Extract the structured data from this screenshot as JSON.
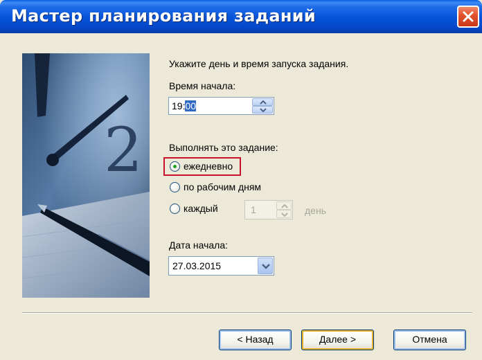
{
  "window": {
    "title": "Мастер планирования заданий"
  },
  "form": {
    "instruction": "Укажите день и время запуска задания.",
    "start_time_label": "Время начала:",
    "start_time_hour": "19:",
    "start_time_minute": "00",
    "run_label": "Выполнять это задание:",
    "options": [
      {
        "label": "ежедневно",
        "selected": true
      },
      {
        "label": "по рабочим дням",
        "selected": false
      },
      {
        "label": "каждый",
        "selected": false
      }
    ],
    "every_n_value": "1",
    "every_n_unit": "день",
    "start_date_label": "Дата начала:",
    "start_date": "27.03.2015"
  },
  "buttons": {
    "back": "< Назад",
    "next": "Далее >",
    "cancel": "Отмена"
  },
  "colors": {
    "titlebar": "#0653d9",
    "highlight": "#c8102e",
    "radio_dot": "#21a121"
  }
}
